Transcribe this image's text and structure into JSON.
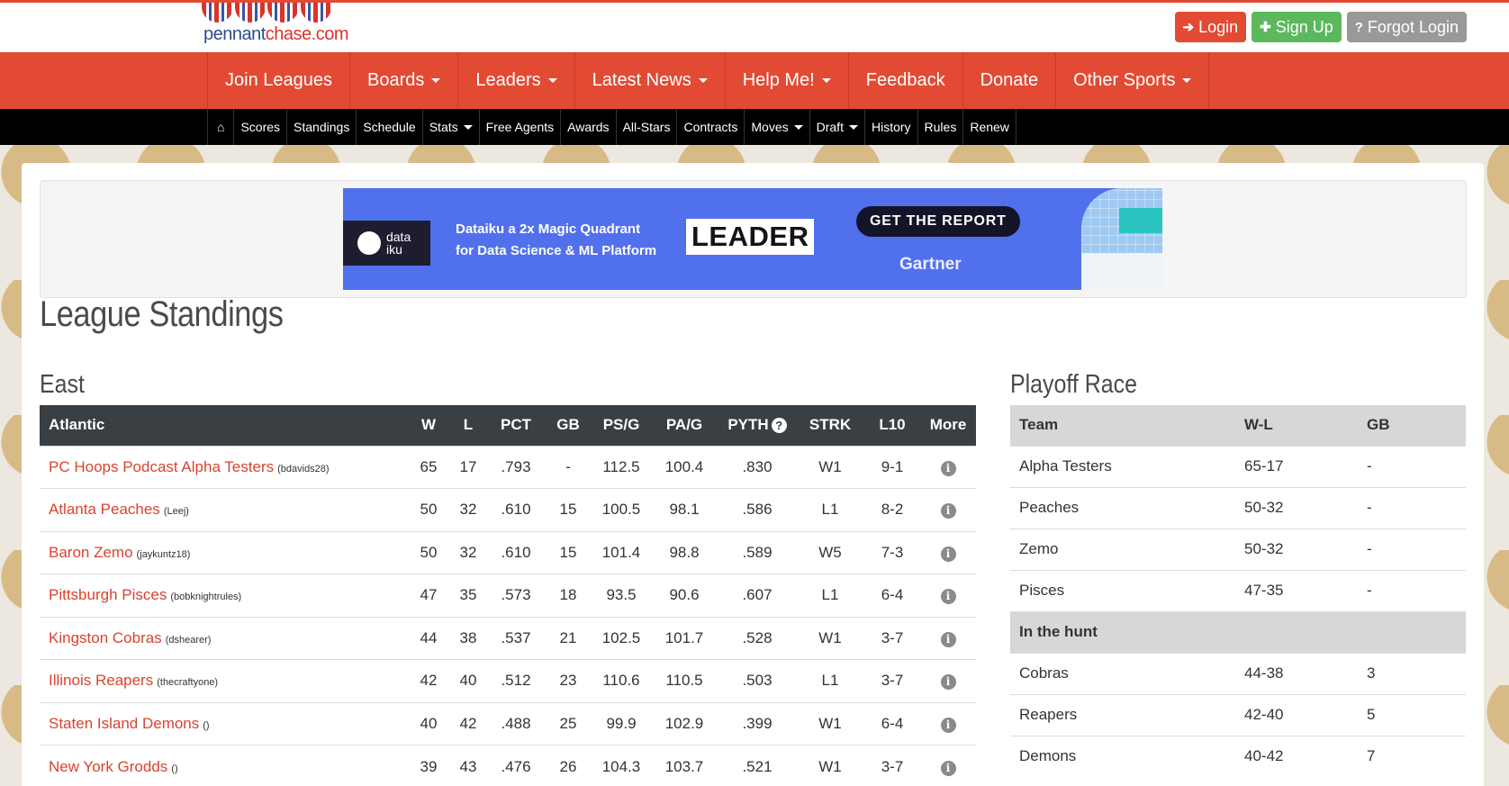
{
  "brand": {
    "logo_text_a": "pennant",
    "logo_text_b": "chase.com"
  },
  "auth": {
    "login": "Login",
    "signup": "Sign Up",
    "forgot": "Forgot Login"
  },
  "main_nav": [
    {
      "label": "Join Leagues",
      "dropdown": false
    },
    {
      "label": "Boards",
      "dropdown": true
    },
    {
      "label": "Leaders",
      "dropdown": true
    },
    {
      "label": "Latest News",
      "dropdown": true
    },
    {
      "label": "Help Me!",
      "dropdown": true
    },
    {
      "label": "Feedback",
      "dropdown": false
    },
    {
      "label": "Donate",
      "dropdown": false
    },
    {
      "label": "Other Sports",
      "dropdown": true
    }
  ],
  "sub_nav": [
    {
      "label": "Scores"
    },
    {
      "label": "Standings"
    },
    {
      "label": "Schedule"
    },
    {
      "label": "Stats"
    },
    {
      "label": "Free Agents"
    },
    {
      "label": "Awards"
    },
    {
      "label": "All-Stars"
    },
    {
      "label": "Contracts"
    },
    {
      "label": "Moves"
    },
    {
      "label": "Draft"
    },
    {
      "label": "History"
    },
    {
      "label": "Rules"
    },
    {
      "label": "Renew"
    }
  ],
  "ad": {
    "logo": "data iku",
    "line1": "Dataiku a 2x Magic Quadrant",
    "line2": "for Data Science & ML Platform",
    "leader": "LEADER",
    "cta": "GET THE REPORT",
    "brand": "Gartner"
  },
  "page_title": "League Standings",
  "east": {
    "title": "East",
    "columns": [
      "Atlantic",
      "W",
      "L",
      "PCT",
      "GB",
      "PS/G",
      "PA/G",
      "PYTH",
      "STRK",
      "L10",
      "More"
    ],
    "rows": [
      {
        "team": "PC Hoops Podcast Alpha Testers",
        "owner": "(bdavids28)",
        "w": "65",
        "l": "17",
        "pct": ".793",
        "gb": "-",
        "psg": "112.5",
        "pag": "100.4",
        "pyth": ".830",
        "strk": "W1",
        "l10": "9-1"
      },
      {
        "team": "Atlanta Peaches",
        "owner": "(Leej)",
        "w": "50",
        "l": "32",
        "pct": ".610",
        "gb": "15",
        "psg": "100.5",
        "pag": "98.1",
        "pyth": ".586",
        "strk": "L1",
        "l10": "8-2"
      },
      {
        "team": "Baron Zemo",
        "owner": "(jaykuntz18)",
        "w": "50",
        "l": "32",
        "pct": ".610",
        "gb": "15",
        "psg": "101.4",
        "pag": "98.8",
        "pyth": ".589",
        "strk": "W5",
        "l10": "7-3"
      },
      {
        "team": "Pittsburgh Pisces",
        "owner": "(bobknightrules)",
        "w": "47",
        "l": "35",
        "pct": ".573",
        "gb": "18",
        "psg": "93.5",
        "pag": "90.6",
        "pyth": ".607",
        "strk": "L1",
        "l10": "6-4"
      },
      {
        "team": "Kingston Cobras",
        "owner": "(dshearer)",
        "w": "44",
        "l": "38",
        "pct": ".537",
        "gb": "21",
        "psg": "102.5",
        "pag": "101.7",
        "pyth": ".528",
        "strk": "W1",
        "l10": "3-7"
      },
      {
        "team": "Illinois Reapers",
        "owner": "(thecraftyone)",
        "w": "42",
        "l": "40",
        "pct": ".512",
        "gb": "23",
        "psg": "110.6",
        "pag": "110.5",
        "pyth": ".503",
        "strk": "L1",
        "l10": "3-7"
      },
      {
        "team": "Staten Island Demons",
        "owner": "()",
        "w": "40",
        "l": "42",
        "pct": ".488",
        "gb": "25",
        "psg": "99.9",
        "pag": "102.9",
        "pyth": ".399",
        "strk": "W1",
        "l10": "6-4"
      },
      {
        "team": "New York Grodds",
        "owner": "()",
        "w": "39",
        "l": "43",
        "pct": ".476",
        "gb": "26",
        "psg": "104.3",
        "pag": "103.7",
        "pyth": ".521",
        "strk": "W1",
        "l10": "3-7"
      }
    ]
  },
  "race": {
    "title": "Playoff Race",
    "columns": [
      "Team",
      "W-L",
      "GB"
    ],
    "rows": [
      {
        "type": "team",
        "team": "Alpha Testers",
        "wl": "65-17",
        "gb": "-"
      },
      {
        "type": "team",
        "team": "Peaches",
        "wl": "50-32",
        "gb": "-"
      },
      {
        "type": "team",
        "team": "Zemo",
        "wl": "50-32",
        "gb": "-"
      },
      {
        "type": "team",
        "team": "Pisces",
        "wl": "47-35",
        "gb": "-"
      },
      {
        "type": "group",
        "team": "In the hunt",
        "wl": "",
        "gb": ""
      },
      {
        "type": "team",
        "team": "Cobras",
        "wl": "44-38",
        "gb": "3"
      },
      {
        "type": "team",
        "team": "Reapers",
        "wl": "42-40",
        "gb": "5"
      },
      {
        "type": "team",
        "team": "Demons",
        "wl": "40-42",
        "gb": "7"
      }
    ]
  }
}
